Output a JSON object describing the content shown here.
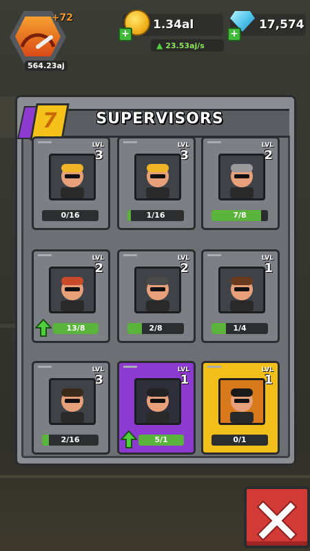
{
  "hud": {
    "level_bonus": "+72",
    "level_cash": "564.23aj",
    "coins": "1.34al",
    "coin_rate": "23.53aj/s",
    "gems": "17,574"
  },
  "panel": {
    "title": "SUPERVISORS",
    "tier": "7"
  },
  "cards": [
    {
      "lvl_label": "LVL",
      "level": "3",
      "progress": "0/16",
      "fill": 0.0,
      "upgrade": false,
      "style": "gray"
    },
    {
      "lvl_label": "LVL",
      "level": "3",
      "progress": "1/16",
      "fill": 0.06,
      "upgrade": false,
      "style": "gray"
    },
    {
      "lvl_label": "LVL",
      "level": "2",
      "progress": "7/8",
      "fill": 0.875,
      "upgrade": false,
      "style": "gray"
    },
    {
      "lvl_label": "LVL",
      "level": "2",
      "progress": "13/8",
      "fill": 1.0,
      "upgrade": true,
      "style": "gray"
    },
    {
      "lvl_label": "LVL",
      "level": "2",
      "progress": "2/8",
      "fill": 0.25,
      "upgrade": false,
      "style": "gray"
    },
    {
      "lvl_label": "LVL",
      "level": "1",
      "progress": "1/4",
      "fill": 0.25,
      "upgrade": false,
      "style": "gray"
    },
    {
      "lvl_label": "LVL",
      "level": "3",
      "progress": "2/16",
      "fill": 0.125,
      "upgrade": false,
      "style": "gray"
    },
    {
      "lvl_label": "LVL",
      "level": "1",
      "progress": "5/1",
      "fill": 1.0,
      "upgrade": true,
      "style": "purple"
    },
    {
      "lvl_label": "LVL",
      "level": "1",
      "progress": "0/1",
      "fill": 0.0,
      "upgrade": false,
      "style": "gold"
    }
  ],
  "colors": {
    "bar_fill": "#5ab33a",
    "close": "#d23a36",
    "gem": "#4fc3ea",
    "coin": "#f2b21c"
  },
  "icons": {
    "close": "close-icon",
    "upgrade": "upgrade-arrow-icon"
  }
}
